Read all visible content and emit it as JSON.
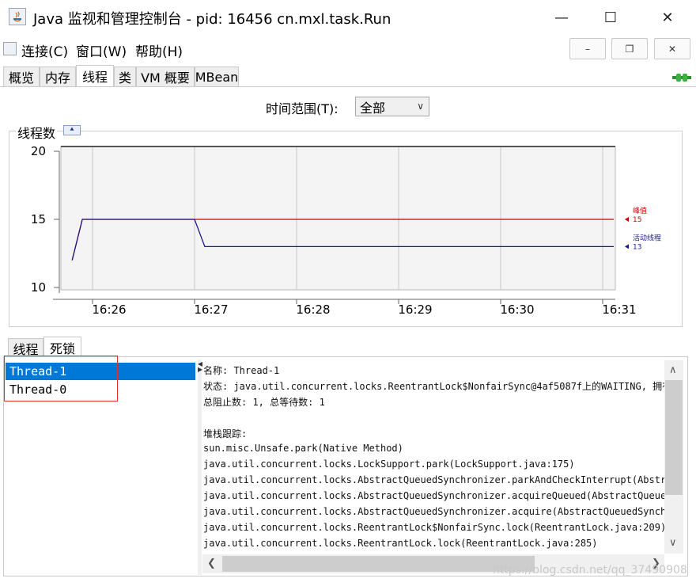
{
  "window": {
    "title": "Java 监视和管理控制台 - pid: 16456 cn.mxl.task.Run",
    "minimize": "—",
    "maximize": "☐",
    "close": "✕"
  },
  "menu": {
    "items": [
      "连接(C)",
      "窗口(W)",
      "帮助(H)"
    ],
    "mdi_minimize": "–",
    "mdi_restore": "❐",
    "mdi_close": "✕"
  },
  "tabs": [
    "概览",
    "内存",
    "线程",
    "类",
    "VM 概要",
    "MBean"
  ],
  "active_tab": "线程",
  "time_range": {
    "label": "时间范围(T):",
    "value": "全部"
  },
  "chart_data": {
    "type": "line",
    "title": "线程数",
    "y_ticks": [
      "20",
      "15",
      "10"
    ],
    "x_ticks": [
      "16:26",
      "16:27",
      "16:28",
      "16:29",
      "16:30",
      "16:31"
    ],
    "ylim": [
      10,
      20
    ],
    "grid": true,
    "series": [
      {
        "name": "峰值",
        "color": "#cc0000",
        "current": "15",
        "points": [
          [
            "16:25.8",
            12
          ],
          [
            "16:25.9",
            15
          ],
          [
            "16:31",
            15
          ]
        ]
      },
      {
        "name": "活动线程",
        "color": "#1a1a8c",
        "current": "13",
        "points": [
          [
            "16:25.8",
            12
          ],
          [
            "16:25.9",
            15
          ],
          [
            "16:27.0",
            15
          ],
          [
            "16:27.1",
            13
          ],
          [
            "16:31",
            13
          ]
        ]
      }
    ]
  },
  "colors": {
    "peak": "#cc0000",
    "live": "#1a1a8c",
    "selection": "#0078d7",
    "highlight_box": "#e0322b"
  },
  "lower_tabs": [
    "线程",
    "死锁"
  ],
  "active_lower_tab": "死锁",
  "threads": [
    "Thread-1",
    "Thread-0"
  ],
  "selected_thread": "Thread-1",
  "detail": {
    "lines": [
      "名称: Thread-1",
      "状态: java.util.concurrent.locks.ReentrantLock$NonfairSync@4af5087f上的WAITING, 拥有",
      "总阻止数: 1, 总等待数: 1",
      "",
      "堆栈跟踪:",
      "sun.misc.Unsafe.park(Native Method)",
      "java.util.concurrent.locks.LockSupport.park(LockSupport.java:175)",
      "java.util.concurrent.locks.AbstractQueuedSynchronizer.parkAndCheckInterrupt(Abstrac",
      "java.util.concurrent.locks.AbstractQueuedSynchronizer.acquireQueued(AbstractQueuedS",
      "java.util.concurrent.locks.AbstractQueuedSynchronizer.acquire(AbstractQueuedSynchro",
      "java.util.concurrent.locks.ReentrantLock$NonfairSync.lock(ReentrantLock.java:209)",
      "java.util.concurrent.locks.ReentrantLock.lock(ReentrantLock.java:285)"
    ]
  },
  "watermark": "https://blog.csdn.net/qq_37490908"
}
